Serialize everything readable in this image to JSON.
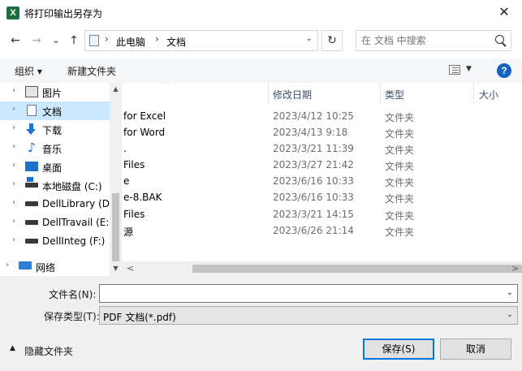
{
  "window": {
    "title": "将打印输出另存为",
    "app_icon": "X",
    "close_glyph": "✕"
  },
  "nav": {
    "back_glyph": "←",
    "forward_glyph": "→",
    "recent_glyph": "⌄",
    "up_glyph": "↑",
    "breadcrumb": [
      "此电脑",
      "文档"
    ],
    "sep_glyph": "›",
    "dropdown_glyph": "⌄",
    "refresh_glyph": "↻",
    "search_placeholder": "在 文档 中搜索"
  },
  "toolbar": {
    "organize": "组织 ▾",
    "new_folder": "新建文件夹",
    "view_dropdown": "▼",
    "help": "?"
  },
  "tree": {
    "chevron": "›",
    "items": [
      {
        "label": "图片",
        "icon": "pictures-icon"
      },
      {
        "label": "文档",
        "icon": "documents-icon",
        "selected": true
      },
      {
        "label": "下载",
        "icon": "downloads-icon"
      },
      {
        "label": "音乐",
        "icon": "music-icon"
      },
      {
        "label": "桌面",
        "icon": "desktop-icon"
      },
      {
        "label": "本地磁盘 (C:)",
        "icon": "local-disk-icon"
      },
      {
        "label": "DellLibrary (D:)",
        "icon": "drive-icon"
      },
      {
        "label": "DellTravail (E:)",
        "icon": "drive-icon"
      },
      {
        "label": "DellInteg (F:)",
        "icon": "drive-icon"
      },
      {
        "label": "网络",
        "icon": "network-icon"
      }
    ],
    "scroll_up": "▲",
    "scroll_down": "▼"
  },
  "files": {
    "sort_arrow": "^",
    "columns": {
      "date": "修改日期",
      "type": "类型",
      "size": "大小"
    },
    "rows": [
      {
        "name": "for Excel",
        "date": "2023/4/12 10:25",
        "type": "文件夹"
      },
      {
        "name": "for Word",
        "date": "2023/4/13 9:18",
        "type": "文件夹"
      },
      {
        "name": ".",
        "date": "2023/3/21 11:39",
        "type": "文件夹"
      },
      {
        "name": "Files",
        "date": "2023/3/27 21:42",
        "type": "文件夹"
      },
      {
        "name": "e",
        "date": "2023/6/16 10:33",
        "type": "文件夹"
      },
      {
        "name": "e-8.BAK",
        "date": "2023/6/16 10:33",
        "type": "文件夹"
      },
      {
        "name": "Files",
        "date": "2023/3/21 14:15",
        "type": "文件夹"
      },
      {
        "name": "源",
        "date": "2023/6/26 21:14",
        "type": "文件夹"
      }
    ],
    "hscroll_left": "<",
    "hscroll_right": ">"
  },
  "form": {
    "filename_label": "文件名(N):",
    "filename_value": "",
    "filetype_label": "保存类型(T):",
    "filetype_value": "PDF 文档(*.pdf)",
    "dropdown_glyph": "⌄",
    "hide_folders": "隐藏文件夹",
    "hide_caret": "▲",
    "save": "保存(S)",
    "cancel": "取消"
  },
  "colors": {
    "selection": "#cce8ff",
    "accent": "#0078d7",
    "help": "#1565c0",
    "excel": "#1d6f42"
  }
}
